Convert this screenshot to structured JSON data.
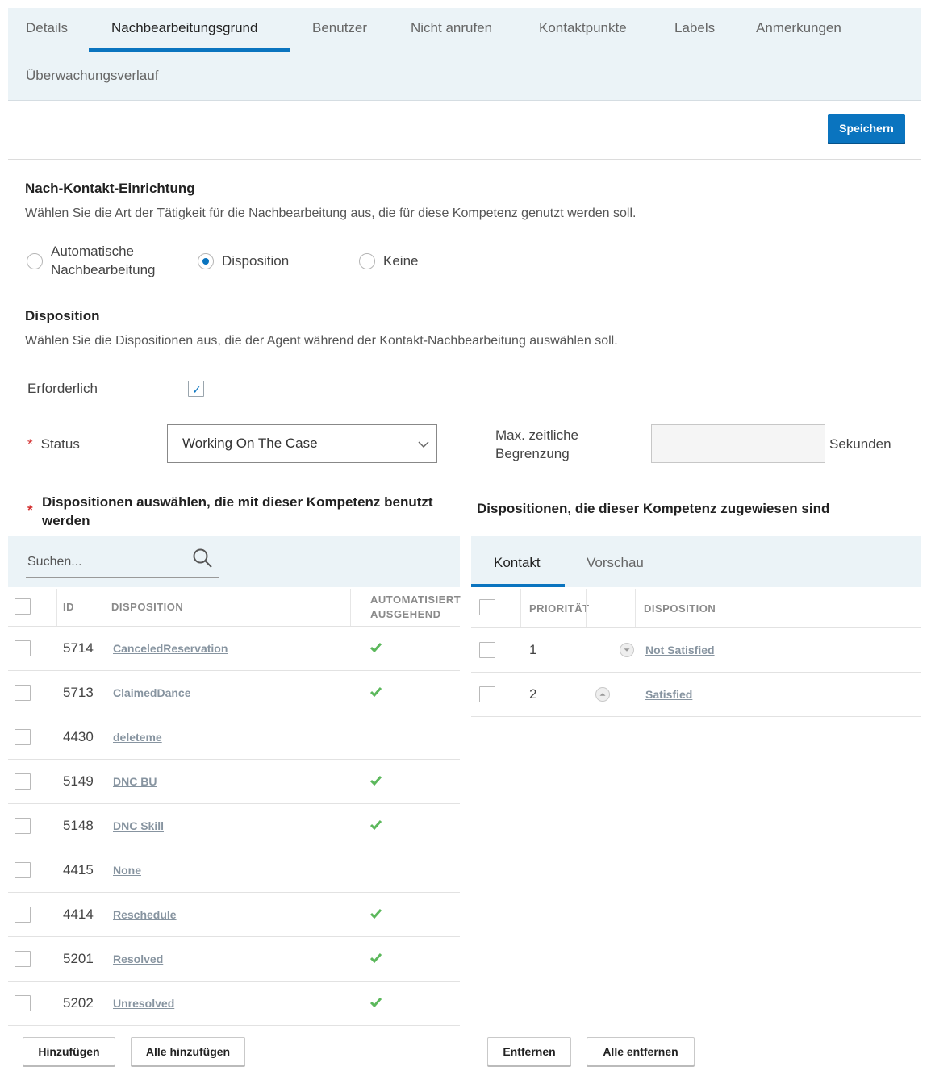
{
  "tabs": [
    {
      "label": "Details",
      "active": false
    },
    {
      "label": "Nachbearbeitungsgrund",
      "active": true
    },
    {
      "label": "Benutzer",
      "active": false
    },
    {
      "label": "Nicht anrufen",
      "active": false
    },
    {
      "label": "Kontaktpunkte",
      "active": false
    },
    {
      "label": "Labels",
      "active": false
    },
    {
      "label": "Anmerkungen",
      "active": false
    },
    {
      "label": "Überwachungsverlauf",
      "active": false
    }
  ],
  "save_label": "Speichern",
  "post_contact": {
    "title": "Nach-Kontakt-Einrichtung",
    "description": "Wählen Sie die Art der Tätigkeit für die Nachbearbeitung aus, die für diese Kompetenz genutzt werden soll.",
    "options": [
      {
        "label_line1": "Automatische",
        "label_line2": "Nachbearbeitung",
        "selected": false
      },
      {
        "label": "Disposition",
        "selected": true
      },
      {
        "label": "Keine",
        "selected": false
      }
    ]
  },
  "disposition": {
    "title": "Disposition",
    "description": "Wählen Sie die Dispositionen aus, die der Agent während der Kontakt-Nachbearbeitung auswählen soll.",
    "required_label": "Erforderlich",
    "required_checked": true,
    "status_label": "Status",
    "status_value": "Working On The Case",
    "max_time_label_line1": "Max. zeitliche",
    "max_time_label_line2": "Begrenzung",
    "max_time_value": "",
    "seconds_label": "Sekunden"
  },
  "left_panel": {
    "title_line1": "Dispositionen auswählen, die mit dieser Kompetenz benutzt",
    "title_line2": "werden",
    "search_placeholder": "Suchen...",
    "headers": {
      "id": "ID",
      "disposition": "DISPOSITION",
      "auto_line1": "AUTOMATISIERT",
      "auto_line2": "AUSGEHEND"
    },
    "rows": [
      {
        "id": "5714",
        "name": "CanceledReservation",
        "auto": true
      },
      {
        "id": "5713",
        "name": "ClaimedDance",
        "auto": true
      },
      {
        "id": "4430",
        "name": "deleteme",
        "auto": false
      },
      {
        "id": "5149",
        "name": "DNC BU",
        "auto": true
      },
      {
        "id": "5148",
        "name": "DNC Skill",
        "auto": true
      },
      {
        "id": "4415",
        "name": "None",
        "auto": false
      },
      {
        "id": "4414",
        "name": "Reschedule",
        "auto": true
      },
      {
        "id": "5201",
        "name": "Resolved",
        "auto": true
      },
      {
        "id": "5202",
        "name": "Unresolved",
        "auto": true
      }
    ],
    "add_label": "Hinzufügen",
    "add_all_label": "Alle hinzufügen"
  },
  "right_panel": {
    "title": "Dispositionen, die dieser Kompetenz zugewiesen sind",
    "tabs": [
      {
        "label": "Kontakt",
        "active": true
      },
      {
        "label": "Vorschau",
        "active": false
      }
    ],
    "headers": {
      "priority": "PRIORITÄT",
      "disposition": "DISPOSITION"
    },
    "rows": [
      {
        "priority": "1",
        "name": "Not Satisfied",
        "move": "down"
      },
      {
        "priority": "2",
        "name": "Satisfied",
        "move": "up"
      }
    ],
    "remove_label": "Entfernen",
    "remove_all_label": "Alle entfernen"
  },
  "colors": {
    "accent": "#0a74bf",
    "panel_bg": "#ebf3f7",
    "check": "#5cb85c",
    "required": "#d32f2f"
  }
}
